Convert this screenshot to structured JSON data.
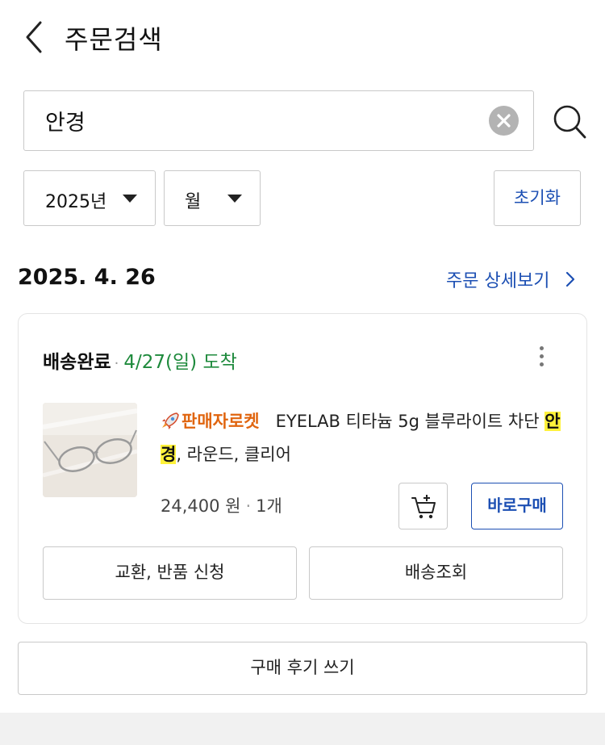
{
  "header": {
    "title": "주문검색",
    "back_icon": "chevron-left-icon"
  },
  "search": {
    "value": "안경",
    "clear_icon": "clear-circle-icon",
    "search_icon": "magnifier-icon"
  },
  "filters": {
    "year_label": "2025년",
    "month_label": "월",
    "reset_label": "초기화"
  },
  "order": {
    "date": "2025. 4. 26",
    "detail_link": "주문 상세보기",
    "status": "배송완료",
    "arrival": "4/27(일) 도착",
    "seller_badge": "판매자로켓",
    "product_name_before": "EYELAB 티타늄 5g 블루라이트 차단",
    "product_highlight": "안경",
    "product_name_after": ", 라운드, 클리어",
    "price": "24,400 원",
    "quantity": "1개",
    "buy_now_label": "바로구매",
    "exchange_label": "교환, 반품 신청",
    "tracking_label": "배송조회"
  },
  "review_label": "구매 후기 쓰기",
  "colors": {
    "accent_blue": "#1c4fb3",
    "arrival_green": "#1e8a3c",
    "seller_orange": "#e0650f",
    "highlight_yellow": "#fff23b"
  }
}
